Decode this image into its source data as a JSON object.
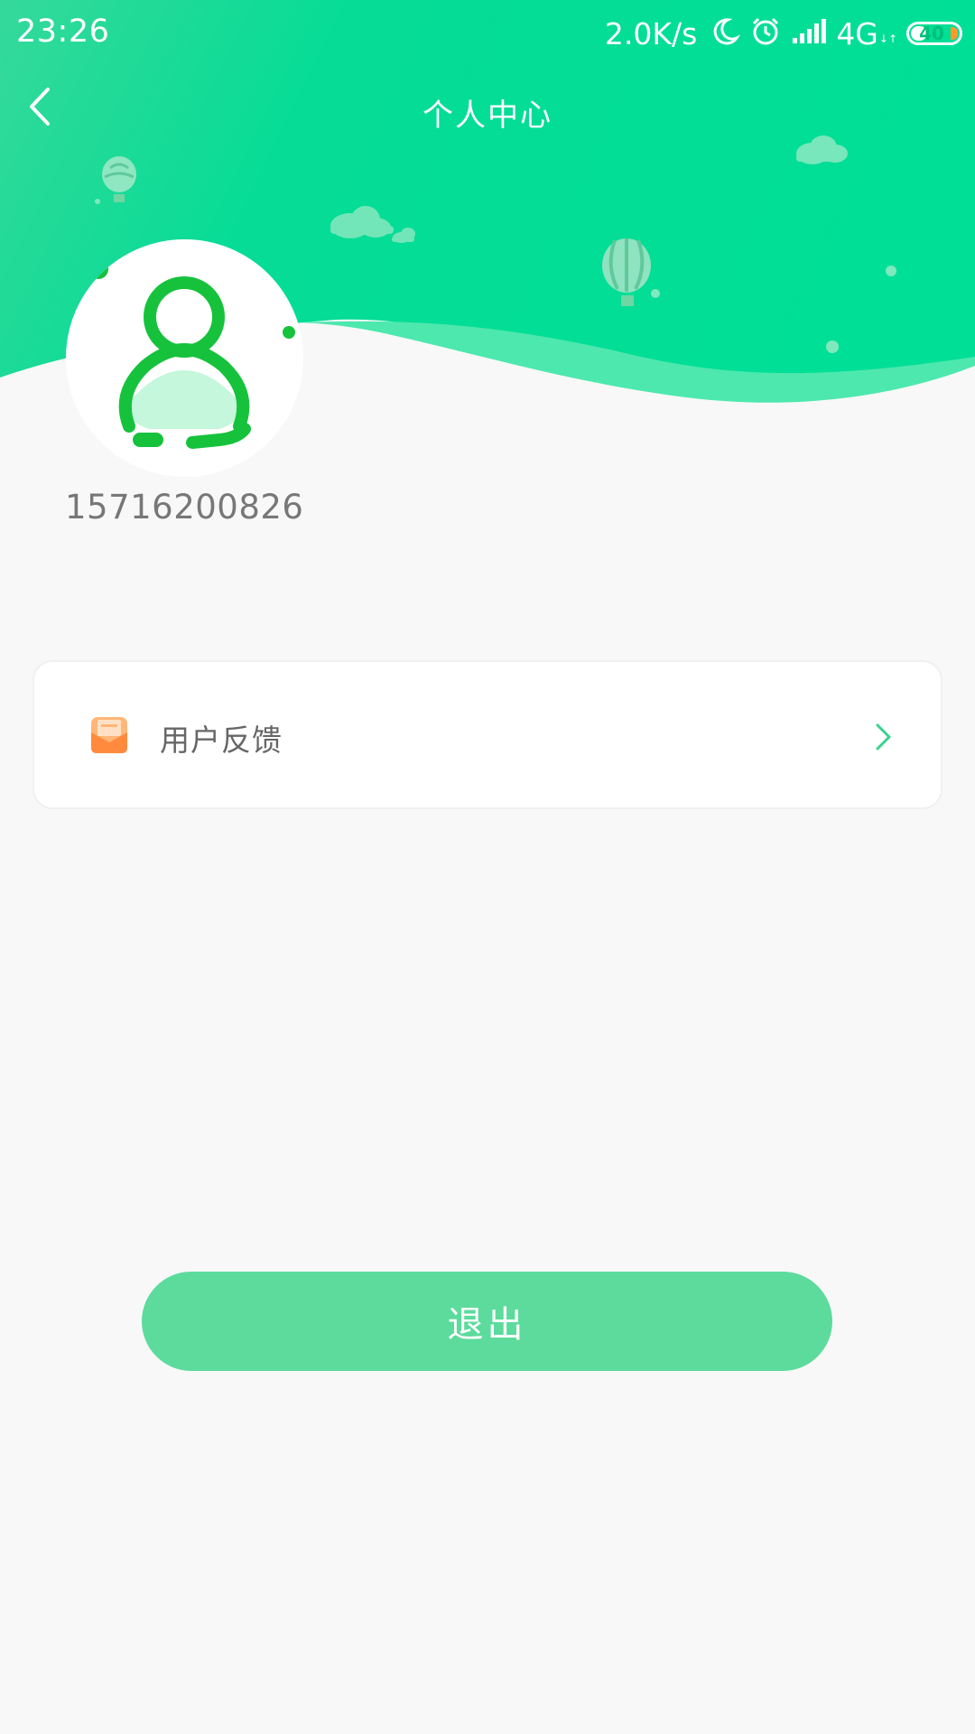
{
  "status_bar": {
    "time": "23:26",
    "net_speed": "2.0K/s",
    "network_type": "4G",
    "network_arrows": "↓↑",
    "battery_level": "40",
    "battery_fraction": 0.4
  },
  "header": {
    "title": "个人中心"
  },
  "profile": {
    "phone": "15716200826"
  },
  "menu": {
    "items": [
      {
        "label": "用户反馈",
        "icon": "envelope-icon"
      }
    ]
  },
  "logout": {
    "label": "退出"
  },
  "colors": {
    "header_green": "#00dc95",
    "wave_light_green": "#4de8ae",
    "background": "#f8f8f8",
    "button_green": "#5cdb9c",
    "avatar_green": "#16c23c",
    "feedback_orange": "#ff8a3d",
    "chevron_green": "#36d38f"
  }
}
